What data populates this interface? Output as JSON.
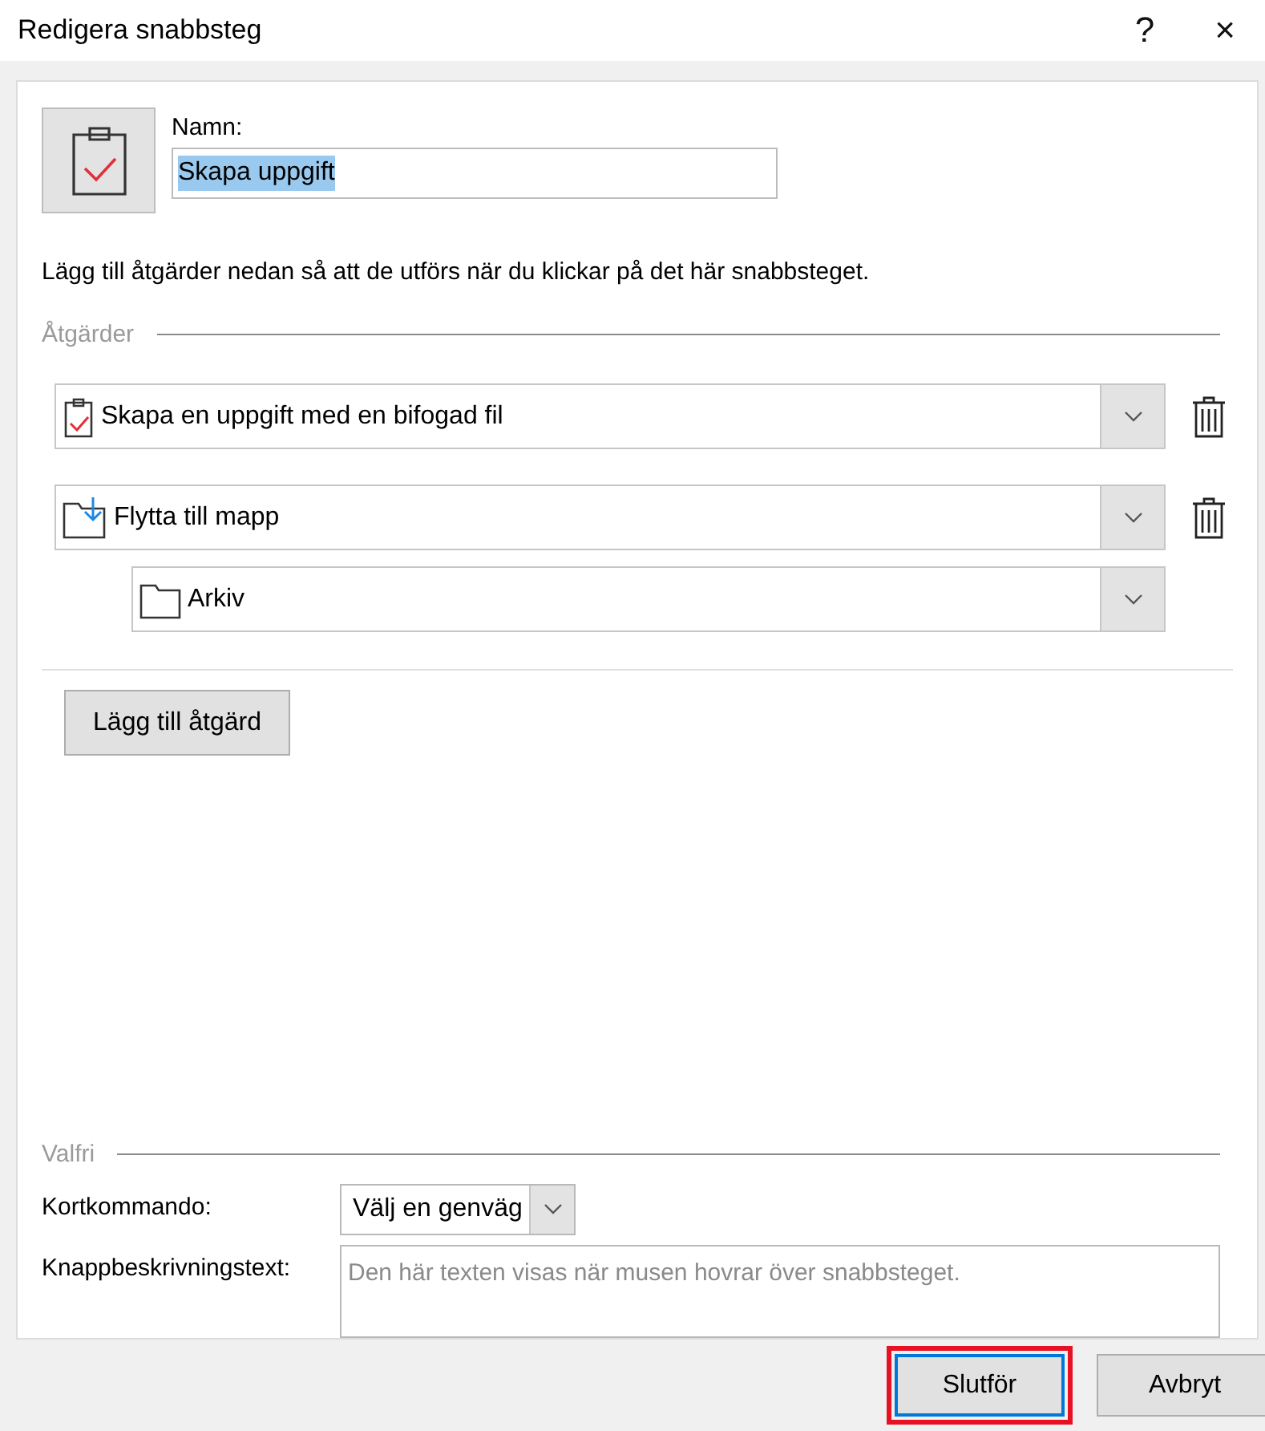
{
  "window": {
    "title": "Redigera snabbsteg",
    "help": "?",
    "close": "×"
  },
  "name": {
    "label": "Namn:",
    "value": "Skapa uppgift",
    "selected": true
  },
  "description": "Lägg till åtgärder nedan så att de utförs när du klickar på det här snabbsteget.",
  "actions_section": {
    "heading": "Åtgärder",
    "actions": [
      {
        "kind": "task",
        "label": "Skapa en uppgift med en bifogad fil"
      },
      {
        "kind": "move",
        "label": "Flytta till mapp",
        "children": [
          {
            "kind": "folder",
            "label": "Arkiv"
          }
        ]
      }
    ],
    "add_button": "Lägg till åtgärd"
  },
  "optional_section": {
    "heading": "Valfri",
    "shortcut_label": "Kortkommando:",
    "shortcut_value": "Välj en genväg",
    "tooltip_label": "Knappbeskrivningstext:",
    "tooltip_placeholder": "Den här texten visas när musen hovrar över snabbsteget."
  },
  "buttons": [
    {
      "label": "Slutför",
      "highlighted": true
    },
    {
      "label": "Avbryt",
      "highlighted": false
    }
  ]
}
